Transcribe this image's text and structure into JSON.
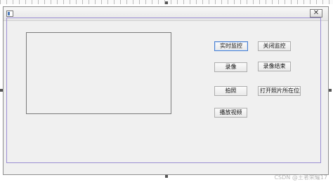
{
  "window": {
    "title": "",
    "close_glyph": "✕"
  },
  "buttons": {
    "realtime_monitor": "实时监控",
    "close_monitor": "关闭监控",
    "record": "录像",
    "stop_record": "录像结束",
    "photo": "拍照",
    "open_photo_location": "打开照片所在位置",
    "play_video": "播放视频"
  },
  "watermark": "CSDN @王者荣耀17",
  "icons": {
    "app": "app-window-icon",
    "close": "close-icon"
  }
}
